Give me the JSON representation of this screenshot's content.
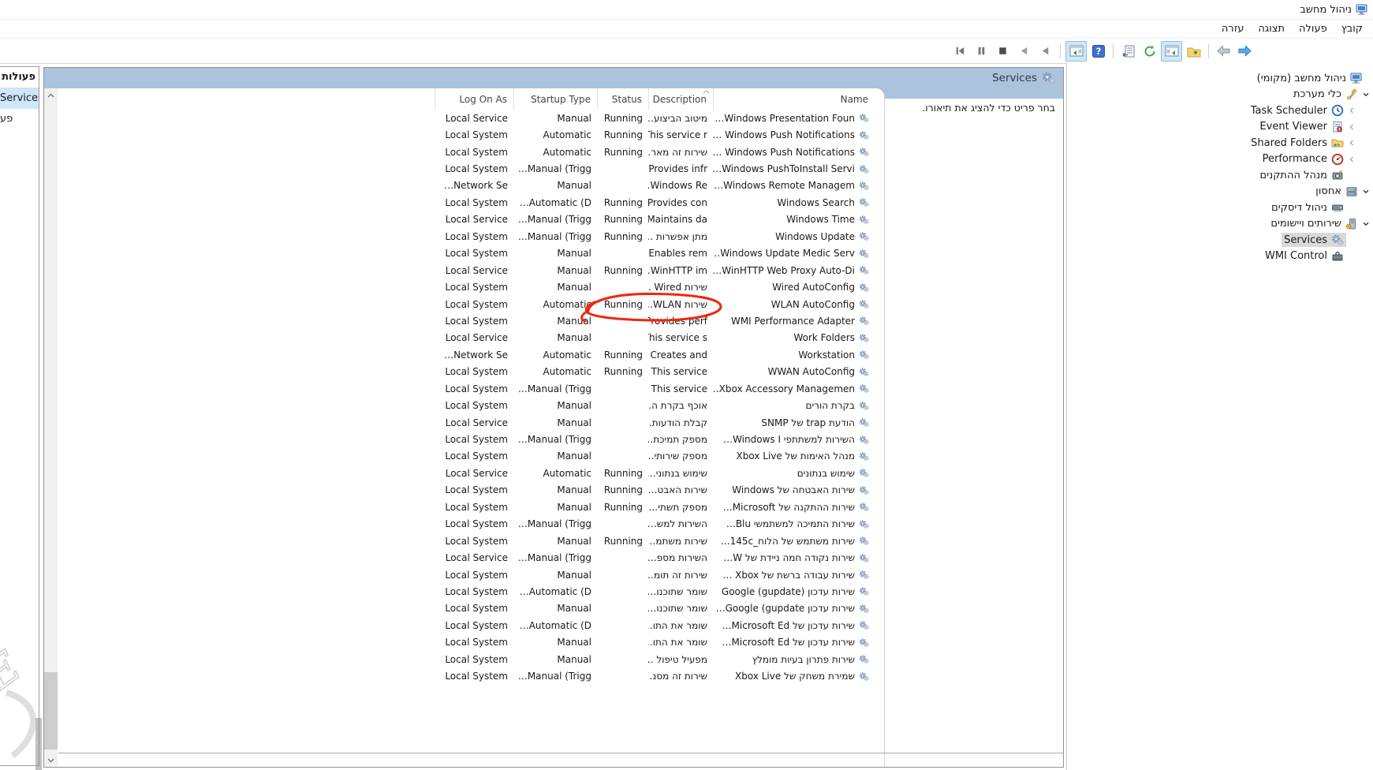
{
  "window": {
    "title": "ניהול מחשב"
  },
  "menu": {
    "items": [
      "קובץ",
      "פעולה",
      "תצוגה",
      "עזרה"
    ]
  },
  "toolbar": {
    "buttons": [
      {
        "name": "nav-back"
      },
      {
        "name": "nav-forward"
      },
      {
        "name": "separator"
      },
      {
        "name": "up-level-folder"
      },
      {
        "name": "show-console-tree",
        "active": true
      },
      {
        "name": "refresh"
      },
      {
        "name": "export-list"
      },
      {
        "name": "separator"
      },
      {
        "name": "help"
      },
      {
        "name": "show-action-pane",
        "active": true
      },
      {
        "name": "separator"
      },
      {
        "name": "start-service"
      },
      {
        "name": "resume-service"
      },
      {
        "name": "stop-service"
      },
      {
        "name": "pause-service"
      },
      {
        "name": "restart-service"
      }
    ]
  },
  "actions_pane": {
    "title": "פעולות",
    "items": [
      {
        "label": "Services",
        "selected": true
      },
      {
        "label": "פע",
        "selected": false
      }
    ]
  },
  "tree": {
    "items": [
      {
        "label": "ניהול מחשב (מקומי)",
        "icon": "computer",
        "depth": 0,
        "chevron": "none",
        "selected": false
      },
      {
        "label": "כלי מערכת",
        "icon": "system-tools",
        "depth": 1,
        "chevron": "expanded",
        "selected": false
      },
      {
        "label": "Task Scheduler",
        "icon": "task-scheduler",
        "depth": 2,
        "chevron": "collapsed",
        "selected": false
      },
      {
        "label": "Event Viewer",
        "icon": "event-viewer",
        "depth": 2,
        "chevron": "collapsed",
        "selected": false
      },
      {
        "label": "Shared Folders",
        "icon": "shared-folders",
        "depth": 2,
        "chevron": "collapsed",
        "selected": false
      },
      {
        "label": "Performance",
        "icon": "performance",
        "depth": 2,
        "chevron": "collapsed",
        "selected": false
      },
      {
        "label": "מנהל ההתקנים",
        "icon": "device-manager",
        "depth": 2,
        "chevron": "none",
        "selected": false
      },
      {
        "label": "אחסון",
        "icon": "storage",
        "depth": 1,
        "chevron": "expanded",
        "selected": false
      },
      {
        "label": "ניהול דיסקים",
        "icon": "disk-management",
        "depth": 2,
        "chevron": "none",
        "selected": false
      },
      {
        "label": "שירותים ויישומים",
        "icon": "services-apps",
        "depth": 1,
        "chevron": "expanded",
        "selected": false
      },
      {
        "label": "Services",
        "icon": "services",
        "depth": 2,
        "chevron": "none",
        "selected": true
      },
      {
        "label": "WMI Control",
        "icon": "wmi-control",
        "depth": 2,
        "chevron": "none",
        "selected": false
      }
    ]
  },
  "services_panel": {
    "header": "Services",
    "hint": "בחר פריט כדי להציג את תיאורו.",
    "columns": [
      "Name",
      "Description",
      "Status",
      "Startup Type",
      "Log On As"
    ],
    "rows": [
      {
        "name": "Windows Presentation Foun…",
        "description": "מיטוב הביצוע…",
        "status": "Running",
        "startup_type": "Manual",
        "log_on_as": "Local Service"
      },
      {
        "name": "Windows Push Notifications …",
        "description": "This service r…",
        "status": "Running",
        "startup_type": "Automatic",
        "log_on_as": "Local System"
      },
      {
        "name": "Windows Push Notifications …",
        "description": "שירות זה מאר…",
        "status": "Running",
        "startup_type": "Automatic",
        "log_on_as": "Local System"
      },
      {
        "name": "Windows PushToInstall Servi…",
        "description": "Provides infr…",
        "status": "",
        "startup_type": "Manual (Trigg…",
        "log_on_as": "Local System"
      },
      {
        "name": "Windows Remote Managem…",
        "description": "Windows Re…",
        "status": "",
        "startup_type": "Manual",
        "log_on_as": "Network Se…"
      },
      {
        "name": "Windows Search",
        "description": "Provides con…",
        "status": "Running",
        "startup_type": "Automatic (D…",
        "log_on_as": "Local System"
      },
      {
        "name": "Windows Time",
        "description": "Maintains da…",
        "status": "Running",
        "startup_type": "Manual (Trigg…",
        "log_on_as": "Local Service"
      },
      {
        "name": "Windows Update",
        "description": "מתן אפשרות …",
        "status": "Running",
        "startup_type": "Manual (Trigg…",
        "log_on_as": "Local System"
      },
      {
        "name": "Windows Update Medic Serv…",
        "description": "Enables rem…",
        "status": "",
        "startup_type": "Manual",
        "log_on_as": "Local System"
      },
      {
        "name": "WinHTTP Web Proxy Auto-Di…",
        "description": "WinHTTP im…",
        "status": "Running",
        "startup_type": "Manual",
        "log_on_as": "Local Service"
      },
      {
        "name": "Wired AutoConfig",
        "description": "שירות Wired …",
        "status": "",
        "startup_type": "Manual",
        "log_on_as": "Local System"
      },
      {
        "name": "WLAN AutoConfig",
        "description": "שירות WLAN…",
        "status": "Running",
        "startup_type": "Automatic",
        "log_on_as": "Local System"
      },
      {
        "name": "WMI Performance Adapter",
        "description": "Provides perf…",
        "status": "",
        "startup_type": "Manual",
        "log_on_as": "Local System"
      },
      {
        "name": "Work Folders",
        "description": "This service s…",
        "status": "",
        "startup_type": "Manual",
        "log_on_as": "Local Service"
      },
      {
        "name": "Workstation",
        "description": "Creates and …",
        "status": "Running",
        "startup_type": "Automatic",
        "log_on_as": "Network Se…"
      },
      {
        "name": "WWAN AutoConfig",
        "description": "This service …",
        "status": "Running",
        "startup_type": "Automatic",
        "log_on_as": "Local System"
      },
      {
        "name": "Xbox Accessory Managemen…",
        "description": "This service …",
        "status": "",
        "startup_type": "Manual (Trigg…",
        "log_on_as": "Local System"
      },
      {
        "name": "בקרת הורים",
        "description": "אוכף בקרת ה…",
        "status": "",
        "startup_type": "Manual",
        "log_on_as": "Local System"
      },
      {
        "name": "הודעת trap של SNMP",
        "description": "קבלת הודעות…",
        "status": "",
        "startup_type": "Manual",
        "log_on_as": "Local Service"
      },
      {
        "name": "השירות למשתתפי Windows I…",
        "description": "מספק תמיכת…",
        "status": "",
        "startup_type": "Manual (Trigg…",
        "log_on_as": "Local System"
      },
      {
        "name": "מנהל האימות של Xbox Live",
        "description": "מספק שירותי…",
        "status": "",
        "startup_type": "Manual",
        "log_on_as": "Local System"
      },
      {
        "name": "שימוש בנתונים",
        "description": "שימוש בנתוני…",
        "status": "Running",
        "startup_type": "Automatic",
        "log_on_as": "Local Service"
      },
      {
        "name": "שירות האבטחה של Windows",
        "description": "שירות האבט…",
        "status": "Running",
        "startup_type": "Manual",
        "log_on_as": "Local System"
      },
      {
        "name": "שירות ההתקנה של Microsoft…",
        "description": "מספק תשתי…",
        "status": "Running",
        "startup_type": "Manual",
        "log_on_as": "Local System"
      },
      {
        "name": "שירות התמיכה למשתמשי Blu…",
        "description": "השירות למש…",
        "status": "",
        "startup_type": "Manual (Trigg…",
        "log_on_as": "Local System"
      },
      {
        "name": "שירות משתמש של הלוח_145c…",
        "description": "שירות משתמ…",
        "status": "Running",
        "startup_type": "Manual",
        "log_on_as": "Local System"
      },
      {
        "name": "שירות נקודה חמה ניידת של W…",
        "description": "השירות מספ…",
        "status": "",
        "startup_type": "Manual (Trigg…",
        "log_on_as": "Local Service"
      },
      {
        "name": "שירות עבודה ברשת של Xbox …",
        "description": "שירות זה תומ…",
        "status": "",
        "startup_type": "Manual",
        "log_on_as": "Local System"
      },
      {
        "name": "שירות עדכון Google (gupdate)",
        "description": "שומר שתוכנו…",
        "status": "",
        "startup_type": "Automatic (D…",
        "log_on_as": "Local System"
      },
      {
        "name": "שירות עדכון Google (gupdate…",
        "description": "שומר שתוכנו…",
        "status": "",
        "startup_type": "Manual",
        "log_on_as": "Local System"
      },
      {
        "name": "שירות עדכון של Microsoft Ed…",
        "description": "שומר את התו…",
        "status": "",
        "startup_type": "Automatic (D…",
        "log_on_as": "Local System"
      },
      {
        "name": "שירות עדכון של Microsoft Ed…",
        "description": "שומר את התו…",
        "status": "",
        "startup_type": "Manual",
        "log_on_as": "Local System"
      },
      {
        "name": "שירות פתרון בעיות מומלץ",
        "description": "מפעיל טיפול …",
        "status": "",
        "startup_type": "Manual",
        "log_on_as": "Local System"
      },
      {
        "name": "שמירת משחק של Xbox Live",
        "description": "שירות זה מסנ…",
        "status": "",
        "startup_type": "Manual (Trigg…",
        "log_on_as": "Local System"
      }
    ]
  },
  "annotation": {
    "shape": "hand-drawn-ellipse",
    "around": "WLAN AutoConfig — Running",
    "color": "#f02711"
  },
  "colors": {
    "panel_header_blue": "#abc3dc",
    "actions_selection_blue": "#cfe7fa",
    "tree_selection_gray": "#d9d9d9",
    "annotation_red": "#f02711"
  }
}
